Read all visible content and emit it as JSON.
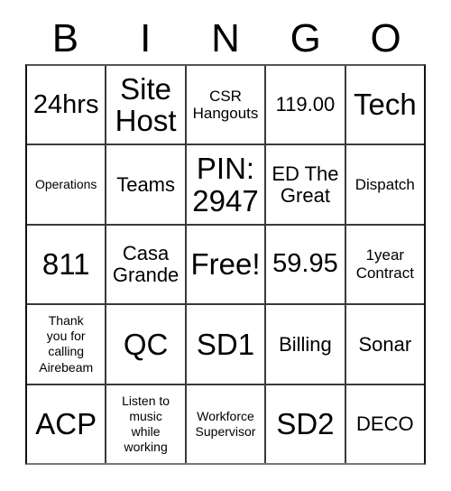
{
  "card": {
    "headers": [
      "B",
      "I",
      "N",
      "G",
      "O"
    ],
    "rows": [
      [
        {
          "text": "24hrs",
          "size": "lg"
        },
        {
          "text": "Site\nHost",
          "size": "xl"
        },
        {
          "text": "CSR\nHangouts",
          "size": "sm"
        },
        {
          "text": "119.00",
          "size": "md"
        },
        {
          "text": "Tech",
          "size": "xl"
        }
      ],
      [
        {
          "text": "Operations",
          "size": "xs"
        },
        {
          "text": "Teams",
          "size": "md"
        },
        {
          "text": "PIN:\n2947",
          "size": "xl"
        },
        {
          "text": "ED The\nGreat",
          "size": "md"
        },
        {
          "text": "Dispatch",
          "size": "sm"
        }
      ],
      [
        {
          "text": "811",
          "size": "xl"
        },
        {
          "text": "Casa\nGrande",
          "size": "md"
        },
        {
          "text": "Free!",
          "size": "xl"
        },
        {
          "text": "59.95",
          "size": "lg"
        },
        {
          "text": "1year\nContract",
          "size": "sm"
        }
      ],
      [
        {
          "text": "Thank\nyou for\ncalling\nAirebeam",
          "size": "xs"
        },
        {
          "text": "QC",
          "size": "xl"
        },
        {
          "text": "SD1",
          "size": "xl"
        },
        {
          "text": "Billing",
          "size": "md"
        },
        {
          "text": "Sonar",
          "size": "md"
        }
      ],
      [
        {
          "text": "ACP",
          "size": "xl"
        },
        {
          "text": "Listen to\nmusic\nwhile\nworking",
          "size": "xs"
        },
        {
          "text": "Workforce\nSupervisor",
          "size": "xs"
        },
        {
          "text": "SD2",
          "size": "xl"
        },
        {
          "text": "DECO",
          "size": "md"
        }
      ]
    ]
  }
}
